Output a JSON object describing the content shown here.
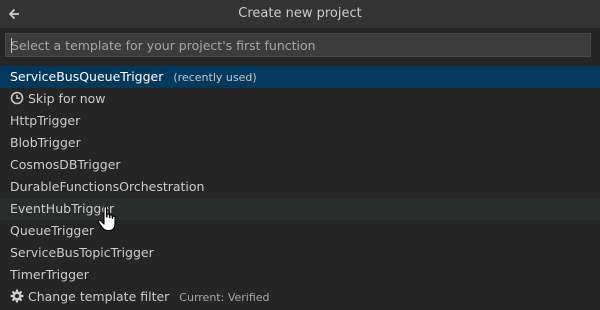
{
  "header": {
    "title": "Create new project",
    "back_icon": "arrow-left-icon"
  },
  "search": {
    "placeholder": "Select a template for your project's first function",
    "value": ""
  },
  "items": [
    {
      "label": "ServiceBusQueueTrigger",
      "hint": "(recently used)",
      "state": "selected"
    },
    {
      "label": "Skip for now",
      "icon": "clock-icon"
    },
    {
      "label": "HttpTrigger"
    },
    {
      "label": "BlobTrigger"
    },
    {
      "label": "CosmosDBTrigger"
    },
    {
      "label": "DurableFunctionsOrchestration"
    },
    {
      "label": "EventHubTrigger",
      "state": "hovered"
    },
    {
      "label": "QueueTrigger"
    },
    {
      "label": "ServiceBusTopicTrigger"
    },
    {
      "label": "TimerTrigger"
    },
    {
      "label": "Change template filter",
      "hint": "Current: Verified",
      "icon": "gear-icon"
    }
  ],
  "colors": {
    "background": "#252526",
    "titlebar": "#333333",
    "selected": "#04395e",
    "hover": "#2a2d2e",
    "text": "#cccccc"
  }
}
